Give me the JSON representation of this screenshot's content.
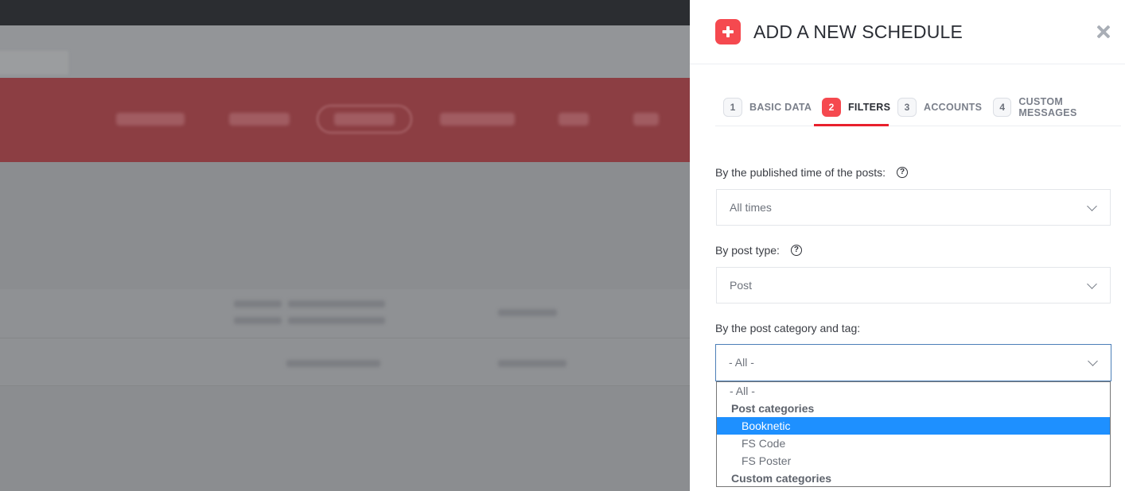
{
  "drawer": {
    "title": "ADD A NEW SCHEDULE",
    "steps": [
      {
        "number": "1",
        "label": "BASIC DATA",
        "active": false
      },
      {
        "number": "2",
        "label": "FILTERS",
        "active": true
      },
      {
        "number": "3",
        "label": "ACCOUNTS",
        "active": false
      },
      {
        "number": "4",
        "label": "CUSTOM MESSAGES",
        "active": false
      }
    ],
    "filters": {
      "published_time": {
        "label": "By the published time of the posts:",
        "value": "All times"
      },
      "post_type": {
        "label": "By post type:",
        "value": "Post"
      },
      "category_tag": {
        "label": "By the post category and tag:",
        "value": "- All -"
      }
    },
    "dropdown_options": [
      {
        "text": "- All -",
        "kind": "option"
      },
      {
        "text": "Post categories",
        "kind": "group"
      },
      {
        "text": "Booknetic",
        "kind": "option",
        "selected": true
      },
      {
        "text": "FS Code",
        "kind": "option"
      },
      {
        "text": "FS Poster",
        "kind": "option"
      },
      {
        "text": "Custom categories",
        "kind": "group"
      }
    ]
  },
  "colors": {
    "accent": "#f5494f",
    "tab_underline": "#e8202c",
    "highlight": "#1e90ff",
    "overlay_nav": "#8c3e43"
  },
  "icons": {
    "add": "plus-icon",
    "close": "close-icon",
    "help": "question-circle-icon",
    "dropdown": "chevron-down-icon"
  }
}
